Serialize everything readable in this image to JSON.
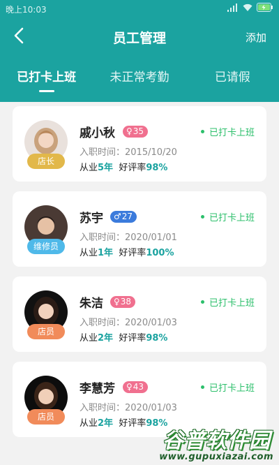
{
  "status_bar": {
    "time": "晚上10:03"
  },
  "header": {
    "title": "员工管理",
    "add_label": "添加",
    "back_icon": "back-arrow-icon"
  },
  "tabs": [
    {
      "label": "已打卡上班",
      "active": true
    },
    {
      "label": "未正常考勤",
      "active": false
    },
    {
      "label": "已请假",
      "active": false
    }
  ],
  "colors": {
    "primary": "#1ba3a0",
    "status_green": "#2cbf6b",
    "female_tag": "#f0708f",
    "male_tag": "#3b7bdc",
    "manager_badge": "#e2b84a",
    "repair_badge": "#4fb9e9",
    "staff_badge": "#f18b5a"
  },
  "employees": [
    {
      "name": "戚小秋",
      "gender_symbol": "♀",
      "age": "35",
      "role": "店长",
      "hire_prefix": "入职时间：",
      "hire_date": "2015/10/20",
      "years_prefix": "从业",
      "years": "5年",
      "rating_prefix": "好评率",
      "rating": "98%",
      "status": "已打卡上班"
    },
    {
      "name": "苏宇",
      "gender_symbol": "♂",
      "age": "27",
      "role": "维修员",
      "hire_prefix": "入职时间：",
      "hire_date": "2020/01/01",
      "years_prefix": "从业",
      "years": "1年",
      "rating_prefix": "好评率",
      "rating": "100%",
      "status": "已打卡上班"
    },
    {
      "name": "朱洁",
      "gender_symbol": "♀",
      "age": "38",
      "role": "店员",
      "hire_prefix": "入职时间：",
      "hire_date": "2020/01/03",
      "years_prefix": "从业",
      "years": "2年",
      "rating_prefix": "好评率",
      "rating": "98%",
      "status": "已打卡上班"
    },
    {
      "name": "李慧芳",
      "gender_symbol": "♀",
      "age": "43",
      "role": "店员",
      "hire_prefix": "入职时间：",
      "hire_date": "2020/01/03",
      "years_prefix": "从业",
      "years": "2年",
      "rating_prefix": "好评率",
      "rating": "98%",
      "status": "已打卡上班"
    }
  ],
  "watermark": {
    "title": "谷普软件园",
    "url": "www.gupuxiazai.com"
  }
}
